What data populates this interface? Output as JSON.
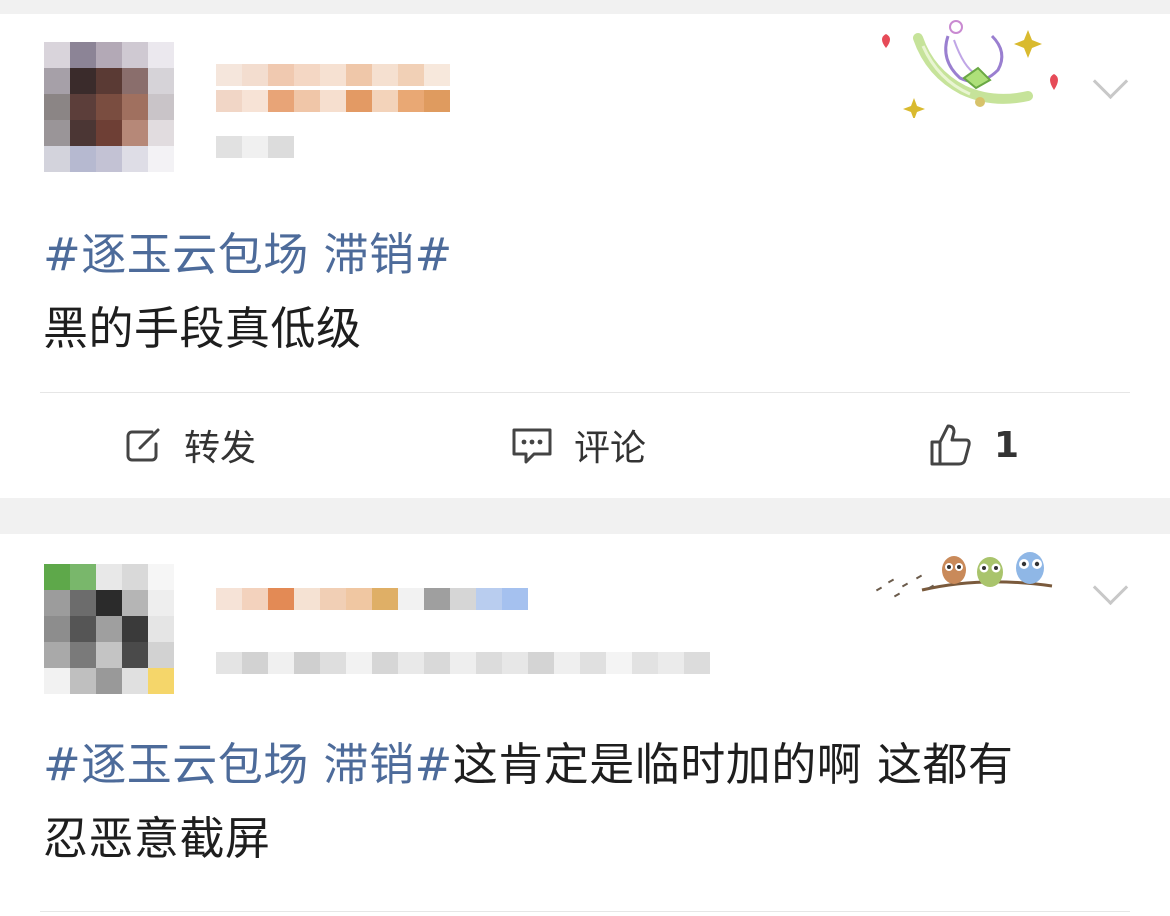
{
  "feed": {
    "posts": [
      {
        "hashtag": "#逐玉云包场 滞销#",
        "body": "黑的手段真低级",
        "actions": {
          "repost_label": "转发",
          "comment_label": "评论",
          "like_count": "1"
        }
      },
      {
        "hashtag": "#逐玉云包场 滞销#",
        "body_line1": "这肯定是临时加的啊 这都有",
        "body_line2": "忍恶意截屏"
      }
    ]
  },
  "colors": {
    "hashtag": "#4d6b9a",
    "text": "#1e1e1e",
    "background": "#f1f1f1",
    "card": "#ffffff"
  },
  "icons": [
    "repost-icon",
    "comment-icon",
    "like-icon",
    "chevron-down-icon"
  ]
}
